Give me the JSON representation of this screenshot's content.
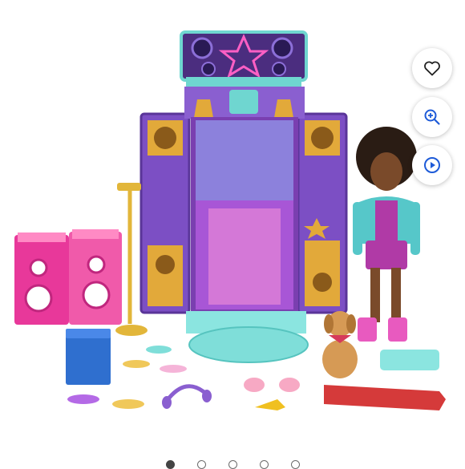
{
  "viewer": {
    "actions": [
      {
        "id": "favorite",
        "icon": "heart-icon"
      },
      {
        "id": "zoom",
        "icon": "zoom-in-icon"
      },
      {
        "id": "video",
        "icon": "play-icon"
      }
    ],
    "carousel": {
      "count": 5,
      "active_index": 0
    }
  },
  "colors": {
    "stage_purple": "#7c4fc4",
    "stage_dark": "#4b2d7f",
    "teal": "#6fd6d0",
    "gold": "#e2a93a",
    "pink_speaker": "#e8389a",
    "blue_box": "#2f6fcf",
    "icon_dark": "#222222",
    "icon_blue": "#1e5bd8"
  }
}
